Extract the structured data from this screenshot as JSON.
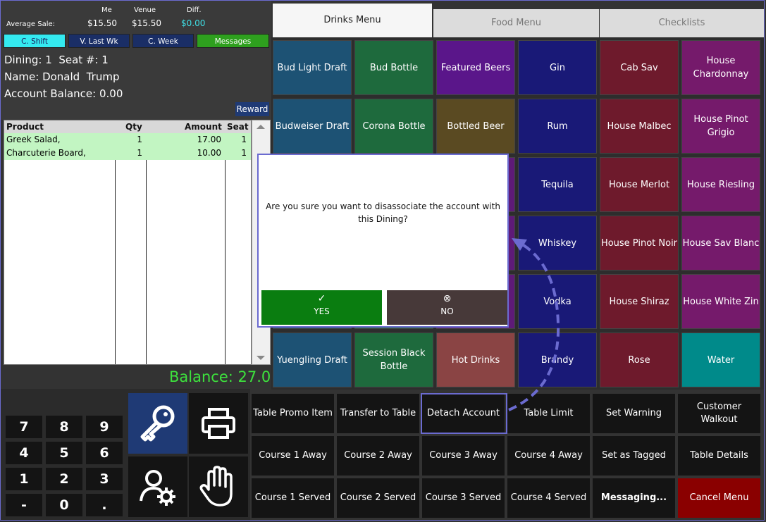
{
  "stats": {
    "avg_label": "Average Sale:",
    "me_label": "Me",
    "venue_label": "Venue",
    "diff_label": "Diff.",
    "me_value": "$15.50",
    "venue_value": "$15.50",
    "diff_value": "$0.00"
  },
  "period_buttons": [
    "C. Shift",
    "V. Last Wk",
    "C. Week",
    "Messages"
  ],
  "dining": {
    "dining_seat": "Dining: 1  Seat #: 1",
    "name": "Name: Donald  Trump",
    "balance": "Account Balance: 0.00",
    "reward_label": "Reward"
  },
  "order": {
    "headers": [
      "Product",
      "Qty",
      "Amount",
      "Seat"
    ],
    "rows": [
      {
        "product": "Greek Salad,",
        "qty": "1",
        "amount": "17.00",
        "seat": "1"
      },
      {
        "product": "Charcuterie Board,",
        "qty": "1",
        "amount": "10.00",
        "seat": "1"
      }
    ]
  },
  "balance_text": "Balance: 27.00",
  "keypad": [
    "7",
    "8",
    "9",
    "4",
    "5",
    "6",
    "1",
    "2",
    "3",
    "-",
    "0",
    "."
  ],
  "tabs": [
    "Drinks Menu",
    "Food Menu",
    "Checklists"
  ],
  "menu_items": [
    [
      "Bud Light Draft",
      "Bud Bottle",
      "Featured Beers",
      "Gin",
      "Cab Sav",
      "House Chardonnay"
    ],
    [
      "Budweiser Draft",
      "Corona Bottle",
      "Bottled Beer",
      "Rum",
      "House Malbec",
      "House Pinot Grigio"
    ],
    [
      "",
      "",
      "",
      "Tequila",
      "House Merlot",
      "House Riesling"
    ],
    [
      "",
      "",
      "",
      "Whiskey",
      "House Pinot Noir",
      "House Sav Blanc"
    ],
    [
      "",
      "",
      "",
      "Vodka",
      "House Shiraz",
      "House White Zin"
    ],
    [
      "Yuengling Draft",
      "Session Black Bottle",
      "Hot Drinks",
      "Brandy",
      "Rose",
      "Water"
    ]
  ],
  "column_colors": [
    "#1d5274",
    "#1e6a3d",
    "#5e1a78",
    "#191977",
    "#6e1a2c",
    "#751a6b"
  ],
  "special_colors": {
    "featured_beers": "#5a168a",
    "bottled_beer": "#5a4a22",
    "hot_drinks": "#8a4444",
    "water": "#008a8a"
  },
  "commands": [
    [
      "Table Promo Item",
      "Transfer to Table",
      "Detach Account",
      "Table Limit",
      "Set Warning",
      "Customer Walkout"
    ],
    [
      "Course 1 Away",
      "Course 2 Away",
      "Course 3 Away",
      "Course 4 Away",
      "Set as Tagged",
      "Table Details"
    ],
    [
      "Course 1 Served",
      "Course 2 Served",
      "Course 3 Served",
      "Course 4 Served",
      "Messaging...",
      "Cancel Menu"
    ]
  ],
  "dialog": {
    "message": "Are you sure you want to disassociate the account with this Dining?",
    "yes_label": "YES",
    "no_label": "NO",
    "yes_icon": "✓",
    "no_icon": "⊗"
  },
  "icons": {
    "login": "key-icon",
    "print": "printer-icon",
    "user_settings": "user-gear-icon",
    "stop": "hand-icon"
  }
}
